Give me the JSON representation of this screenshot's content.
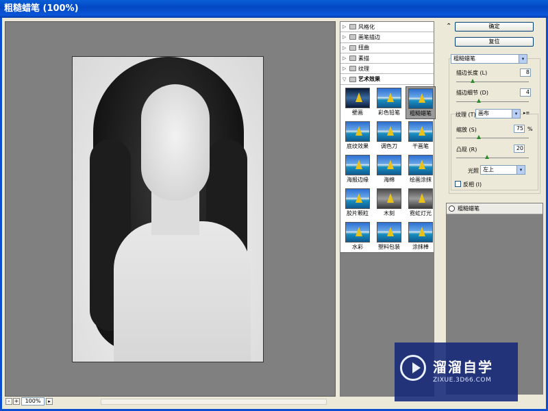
{
  "window": {
    "title": "粗糙蜡笔 (100%)"
  },
  "preview": {
    "zoom": "100%",
    "zoom_minus": "-",
    "zoom_plus": "+",
    "zoom_arrow": "▸"
  },
  "filter_panel": {
    "categories": [
      {
        "label": "风格化",
        "expanded": false
      },
      {
        "label": "画笔描边",
        "expanded": false
      },
      {
        "label": "扭曲",
        "expanded": false
      },
      {
        "label": "素描",
        "expanded": false
      },
      {
        "label": "纹理",
        "expanded": false
      },
      {
        "label": "艺术效果",
        "expanded": true
      }
    ],
    "thumbnails": [
      {
        "label": "壁画"
      },
      {
        "label": "彩色铅笔"
      },
      {
        "label": "粗糙蜡笔",
        "selected": true
      },
      {
        "label": "底纹效果"
      },
      {
        "label": "调色刀"
      },
      {
        "label": "干画笔"
      },
      {
        "label": "海报边缘"
      },
      {
        "label": "海绵"
      },
      {
        "label": "绘画涂抹"
      },
      {
        "label": "胶片颗粒"
      },
      {
        "label": "木刻"
      },
      {
        "label": "霓虹灯光"
      },
      {
        "label": "水彩"
      },
      {
        "label": "塑料包装"
      },
      {
        "label": "涂抹棒"
      }
    ],
    "arrows": {
      "collapsed": "▷",
      "expanded": "▽"
    }
  },
  "buttons": {
    "ok": "确定",
    "reset": "复位",
    "collapse": "⌃"
  },
  "settings": {
    "filter_select": "粗糙蜡笔",
    "stroke_length": {
      "label": "描边长度 (L)",
      "value": "8",
      "level": 0.2
    },
    "stroke_detail": {
      "label": "描边细节 (D)",
      "value": "4",
      "level": 0.28
    },
    "texture": {
      "label": "纹理 (T):",
      "value": "画布"
    },
    "scaling": {
      "label": "缩放 (S)",
      "value": "75",
      "unit": "%",
      "level": 0.28
    },
    "relief": {
      "label": "凸现 (R)",
      "value": "20",
      "level": 0.4
    },
    "light": {
      "label": "光照 (L):",
      "value": "左上"
    },
    "invert": {
      "label": "反相 (I)",
      "checked": false
    },
    "dropdown_glyph": "▾",
    "menu_glyph": "▸≡"
  },
  "layers": [
    {
      "label": "粗糙蜡笔",
      "visible": true
    }
  ],
  "watermark": {
    "name": "溜溜自学",
    "url": "ZIXUE.3D66.COM"
  },
  "colors": {
    "title_bar": "#0348c4",
    "canvas_bg": "#808080",
    "watermark_bg": "#14287a"
  }
}
